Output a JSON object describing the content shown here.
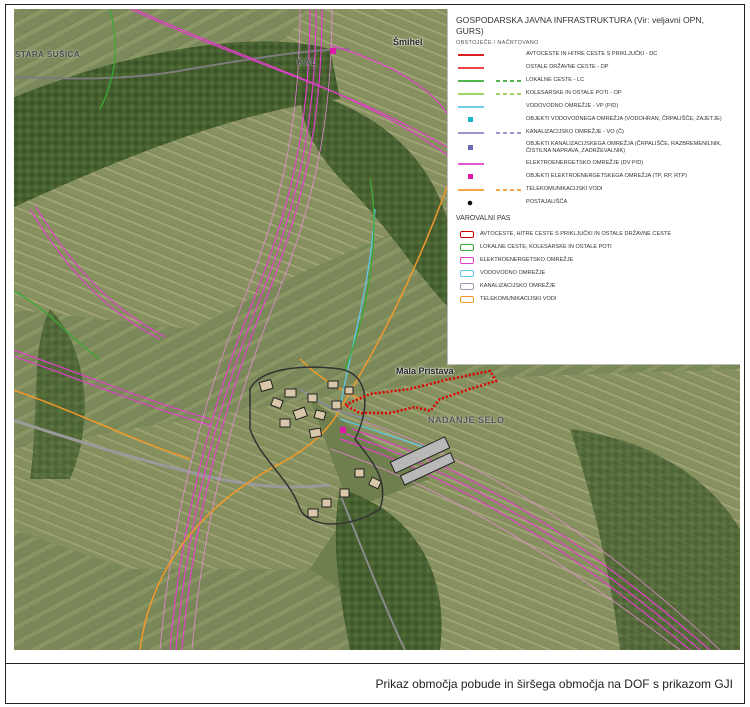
{
  "map": {
    "places": {
      "stara_susica": "STARA SUŠICA",
      "kal": "KAL",
      "smihel": "Šmihel",
      "mala_pristava": "Mala Pristava",
      "nadanje_selo": "NADANJE SELO"
    }
  },
  "legend": {
    "title": "GOSPODARSKA JAVNA INFRASTRUKTURA (Vir: veljavni OPN, GURS)",
    "subtitle": "OBSTOJEČE / NAČRTOVANO",
    "items": [
      {
        "label": "AVTOCESTE IN HITRE CESTE S PRIKLJUČKI - DC",
        "color": "#d40000",
        "kind": "line"
      },
      {
        "label": "OSTALE DRŽAVNE CESTE - DP",
        "color": "#e8282c",
        "kind": "line"
      },
      {
        "label": "LOKALNE CESTE - LC",
        "color": "#3aaa35",
        "kind": "line"
      },
      {
        "label": "KOLESARSKE IN OSTALE POTI - OP",
        "color": "#8fd14f",
        "kind": "line"
      },
      {
        "label": "VODOVODNO OMREŽJE - VP (p/d)",
        "color": "#5ec8e8",
        "kind": "line"
      },
      {
        "label": "OBJEKTI VODOVODNEGA OMREŽJA (VODOHRAN, ČRPALIŠČE, ZAJETJE)",
        "color": "#18b4c8",
        "kind": "square"
      },
      {
        "label": "KANALIZACIJSKO OMREŽJE - VO (č)",
        "color": "#8a8ac8",
        "kind": "line"
      },
      {
        "label": "OBJEKTI KANALIZACIJSKEGA OMREŽJA (ČRPALIŠČE, RAZBREMENILNIK, ČISTILNA NAPRAVA, ZADRŽEVALNIK)",
        "color": "#6a6ab8",
        "kind": "square"
      },
      {
        "label": "ELEKTROENERGETSKO OMREŽJE (DV p/d)",
        "color": "#e040c8",
        "kind": "line"
      },
      {
        "label": "OBJEKTI ELEKTROENERGETSKEGA OMREŽJA (TP, RP, RTP)",
        "color": "#e01aa8",
        "kind": "square"
      },
      {
        "label": "TELEKOMUNIKACIJSKI VODI",
        "color": "#f09a2a",
        "kind": "line"
      },
      {
        "label": "POSTAJALIŠČA",
        "color": "#111111",
        "kind": "dot"
      }
    ],
    "buffer_title": "VAROVALNI PAS",
    "buffers": [
      {
        "label": "AVTOCESTE, HITRE CESTE S PRIKLJUČKI IN OSTALE DRŽAVNE CESTE",
        "color": "#d40000"
      },
      {
        "label": "LOKALNE CESTE, KOLESARSKE IN OSTALE POTI",
        "color": "#3aaa35"
      },
      {
        "label": "ELEKTROENERGETSKO OMREŽJE",
        "color": "#e040c8"
      },
      {
        "label": "VODOVODNO OMREŽJE",
        "color": "#5ec8e8"
      },
      {
        "label": "KANALIZACIJSKO OMREŽJE",
        "color": "#9a9ab0"
      },
      {
        "label": "TELEKOMUNIKACIJSKI VODI",
        "color": "#f09a2a"
      }
    ]
  },
  "caption": "Prikaz območja pobude in širšega območja na DOF s prikazom GJI"
}
